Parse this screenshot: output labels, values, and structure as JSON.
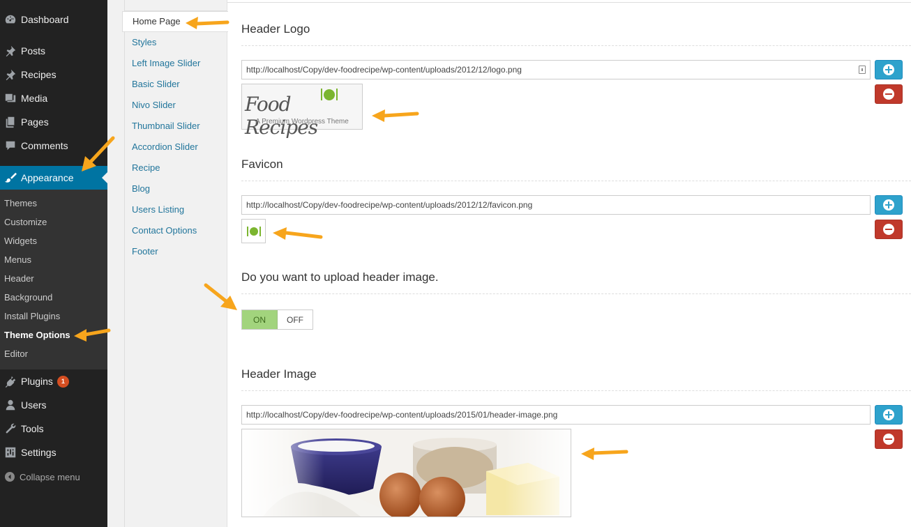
{
  "sidebar": {
    "items": [
      {
        "label": "Dashboard",
        "icon": "dashboard-icon"
      },
      {
        "label": "Posts",
        "icon": "pin-icon"
      },
      {
        "label": "Recipes",
        "icon": "pin-icon"
      },
      {
        "label": "Media",
        "icon": "media-icon"
      },
      {
        "label": "Pages",
        "icon": "pages-icon"
      },
      {
        "label": "Comments",
        "icon": "comment-icon"
      },
      {
        "label": "Appearance",
        "icon": "brush-icon"
      },
      {
        "label": "Plugins",
        "icon": "plugin-icon",
        "badge": "1"
      },
      {
        "label": "Users",
        "icon": "user-icon"
      },
      {
        "label": "Tools",
        "icon": "wrench-icon"
      },
      {
        "label": "Settings",
        "icon": "settings-icon"
      }
    ],
    "appearance_submenu": [
      "Themes",
      "Customize",
      "Widgets",
      "Menus",
      "Header",
      "Background",
      "Install Plugins",
      "Theme Options",
      "Editor"
    ],
    "collapse_label": "Collapse menu",
    "active_color": "#0074a2"
  },
  "options_nav": {
    "items": [
      "Home Page",
      "Styles",
      "Left Image Slider",
      "Basic Slider",
      "Nivo Slider",
      "Thumbnail Slider",
      "Accordion Slider",
      "Recipe",
      "Blog",
      "Users Listing",
      "Contact Options",
      "Footer"
    ],
    "current": "Home Page"
  },
  "main": {
    "header_logo": {
      "title": "Header Logo",
      "url": "http://localhost/Copy/dev-foodrecipe/wp-content/uploads/2012/12/logo.png",
      "logo_text": "Food Recipes",
      "logo_tagline": "A Premium Wordpress Theme"
    },
    "favicon": {
      "title": "Favicon",
      "url": "http://localhost/Copy/dev-foodrecipe/wp-content/uploads/2012/12/favicon.png"
    },
    "upload_question": {
      "title": "Do you want to upload header image.",
      "on_label": "ON",
      "off_label": "OFF",
      "state": "ON"
    },
    "header_image": {
      "title": "Header Image",
      "url": "http://localhost/Copy/dev-foodrecipe/wp-content/uploads/2015/01/header-image.png"
    }
  },
  "colors": {
    "add_button": "#2ea2cc",
    "remove_button": "#c0392b",
    "toggle_on": "#a2d47d",
    "annotation_arrow": "#f7a51c"
  }
}
